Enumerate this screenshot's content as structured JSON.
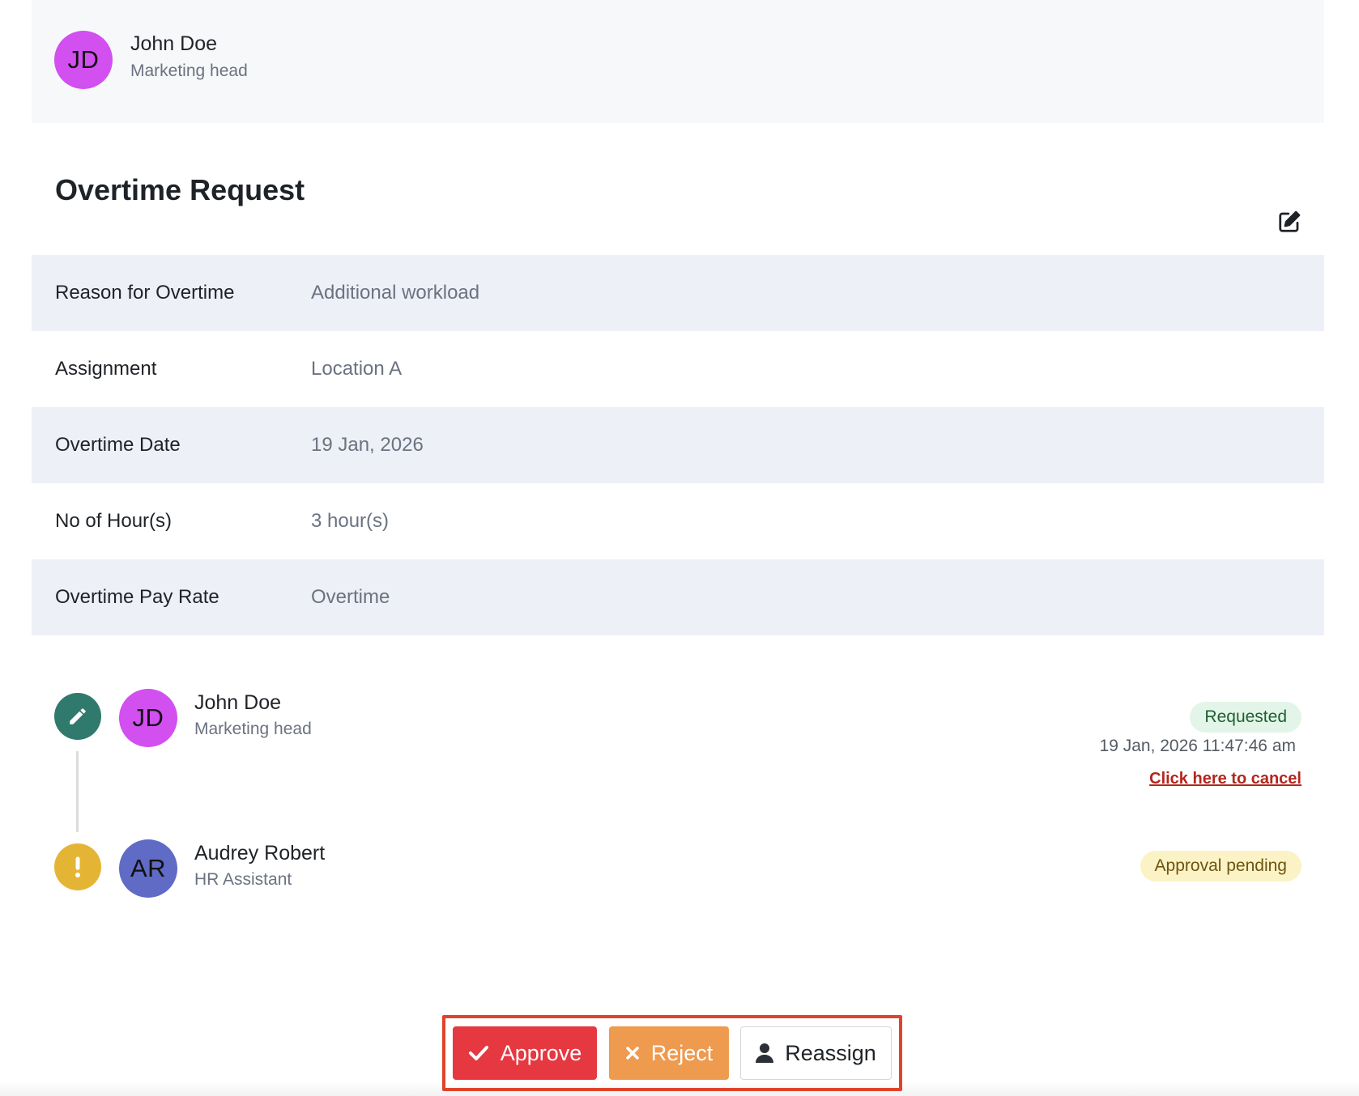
{
  "requester": {
    "initials": "JD",
    "name": "John Doe",
    "role": "Marketing head",
    "avatar_color": "#d24ff0"
  },
  "page_title": "Overtime Request",
  "edit_icon": "edit-icon",
  "details": [
    {
      "label": "Reason for Overtime",
      "value": "Additional workload"
    },
    {
      "label": "Assignment",
      "value": "Location A"
    },
    {
      "label": "Overtime Date",
      "value": "19 Jan, 2026"
    },
    {
      "label": "No of Hour(s)",
      "value": "3 hour(s)"
    },
    {
      "label": "Overtime Pay Rate",
      "value": "Overtime"
    }
  ],
  "timeline": [
    {
      "status_icon": "pencil-icon",
      "status_color": "#2f7a6c",
      "initials": "JD",
      "name": "John Doe",
      "role": "Marketing head",
      "avatar_color": "#d24ff0",
      "badge": "Requested",
      "timestamp": "19 Jan, 2026 11:47:46 am",
      "cancel_link": "Click here to cancel"
    },
    {
      "status_icon": "exclamation-icon",
      "status_color": "#e4b535",
      "initials": "AR",
      "name": "Audrey Robert",
      "role": "HR Assistant",
      "avatar_color": "#5f6bc4",
      "badge": "Approval pending"
    }
  ],
  "actions": {
    "approve": "Approve",
    "reject": "Reject",
    "reassign": "Reassign",
    "approve_color": "#e63841",
    "reject_color": "#ee9a4f",
    "highlight_color": "#e0432b"
  }
}
